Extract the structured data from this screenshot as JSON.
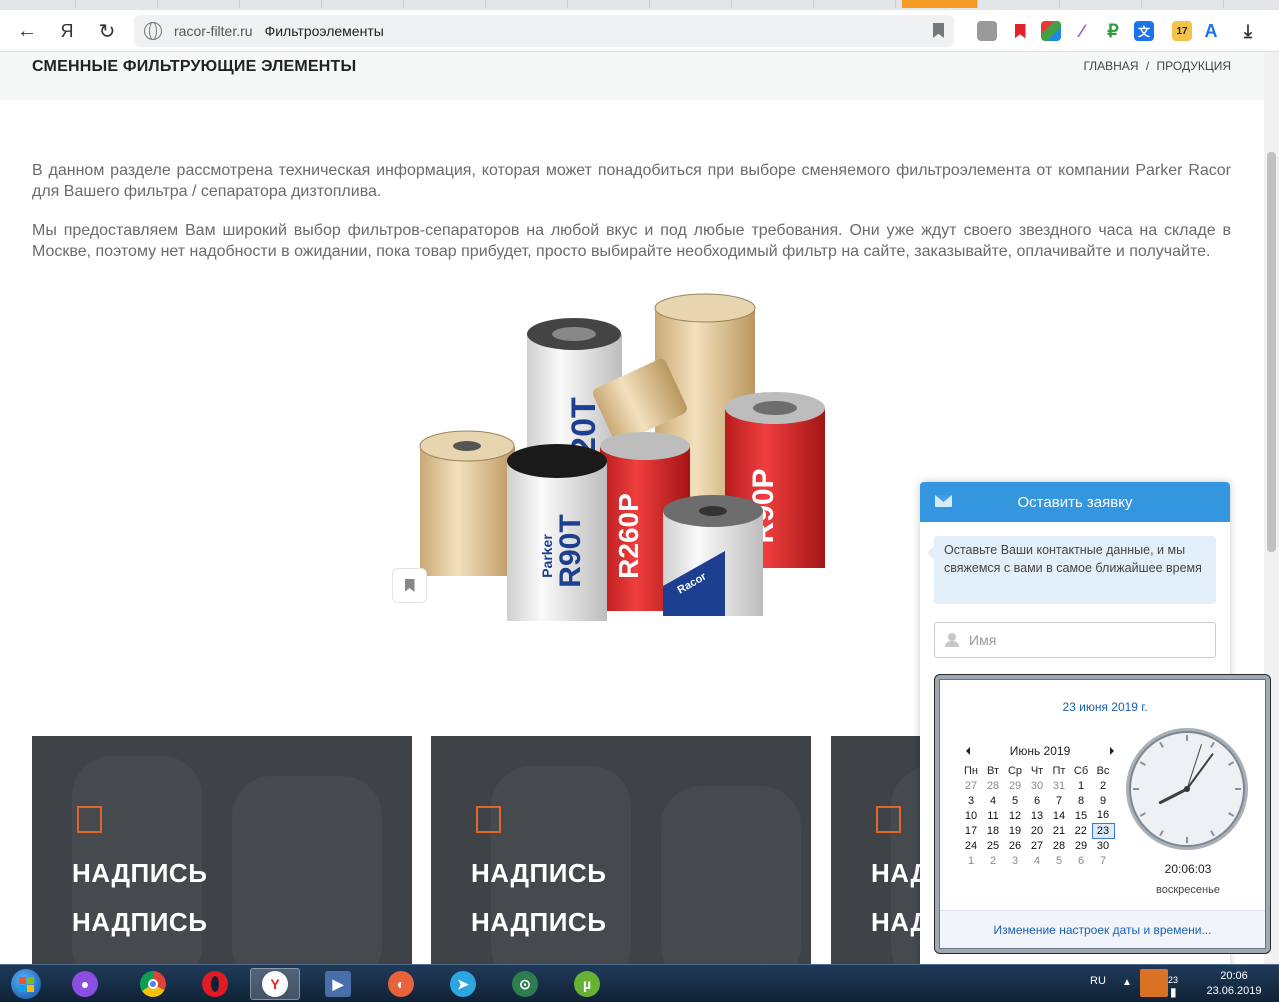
{
  "browser": {
    "domain": "racor-filter.ru",
    "page_title": "Фильтроэлементы",
    "nav": {
      "back": "←",
      "yandex": "Я",
      "reload": "↻"
    },
    "extensions": [
      "₽",
      "A",
      "17"
    ]
  },
  "page": {
    "heading": "СМЕННЫЕ ФИЛЬТРУЮЩИЕ ЭЛЕМЕНТЫ",
    "breadcrumb": {
      "home": "ГЛАВНАЯ",
      "separator": "/",
      "current": "ПРОДУКЦИЯ"
    },
    "paragraphs": [
      "В данном разделе рассмотрена техническая информация, которая может понадобиться при выборе сменяемого фильтроэлемента от компании Parker Racor для Вашего фильтра / сепаратора дизтоплива.",
      "Мы предоставляем Вам широкий выбор фильтров-сепараторов на любой вкус и под любые требования. Они уже ждут своего звездного часа на складе в Москве, поэтому нет надобности в ожидании, пока товар прибудет, просто выбирайте необходимый фильтр на сайте, заказывайте, оплачивайте и получайте."
    ],
    "product_labels": [
      "120T",
      "R90T",
      "R260P",
      "R90P",
      "Parker",
      "Racor"
    ],
    "cards": [
      {
        "line1": "НАДПИСЬ",
        "line2": "НАДПИСЬ"
      },
      {
        "line1": "НАДПИСЬ",
        "line2": "НАДПИСЬ"
      },
      {
        "line1": "НАДПИСЬ",
        "line2": "НАДПИСЬ"
      }
    ]
  },
  "widget": {
    "title": "Оставить заявку",
    "message": "Оставьте Ваши контактные данные, и мы свяжемся с вами в самое ближайшее время",
    "name_placeholder": "Имя"
  },
  "flyout": {
    "date_link": "23 июня 2019 г.",
    "month": "Июнь 2019",
    "weekdays": [
      "Пн",
      "Вт",
      "Ср",
      "Чт",
      "Пт",
      "Сб",
      "Вс"
    ],
    "weeks": [
      [
        "27",
        "28",
        "29",
        "30",
        "31",
        "1",
        "2"
      ],
      [
        "3",
        "4",
        "5",
        "6",
        "7",
        "8",
        "9"
      ],
      [
        "10",
        "11",
        "12",
        "13",
        "14",
        "15",
        "16"
      ],
      [
        "17",
        "18",
        "19",
        "20",
        "21",
        "22",
        "23"
      ],
      [
        "24",
        "25",
        "26",
        "27",
        "28",
        "29",
        "30"
      ],
      [
        "1",
        "2",
        "3",
        "4",
        "5",
        "6",
        "7"
      ]
    ],
    "today": "23",
    "time": "20:06:03",
    "day_of_week": "воскресенье",
    "settings_link": "Изменение настроек даты и времени..."
  },
  "taskbar": {
    "language": "RU",
    "clock_time": "20:06",
    "clock_date": "23.06.2019",
    "tray_day": "23"
  },
  "colors": {
    "accent_orange": "#f07a22",
    "widget_blue": "#3596e0",
    "card_bg": "#3f4247"
  }
}
